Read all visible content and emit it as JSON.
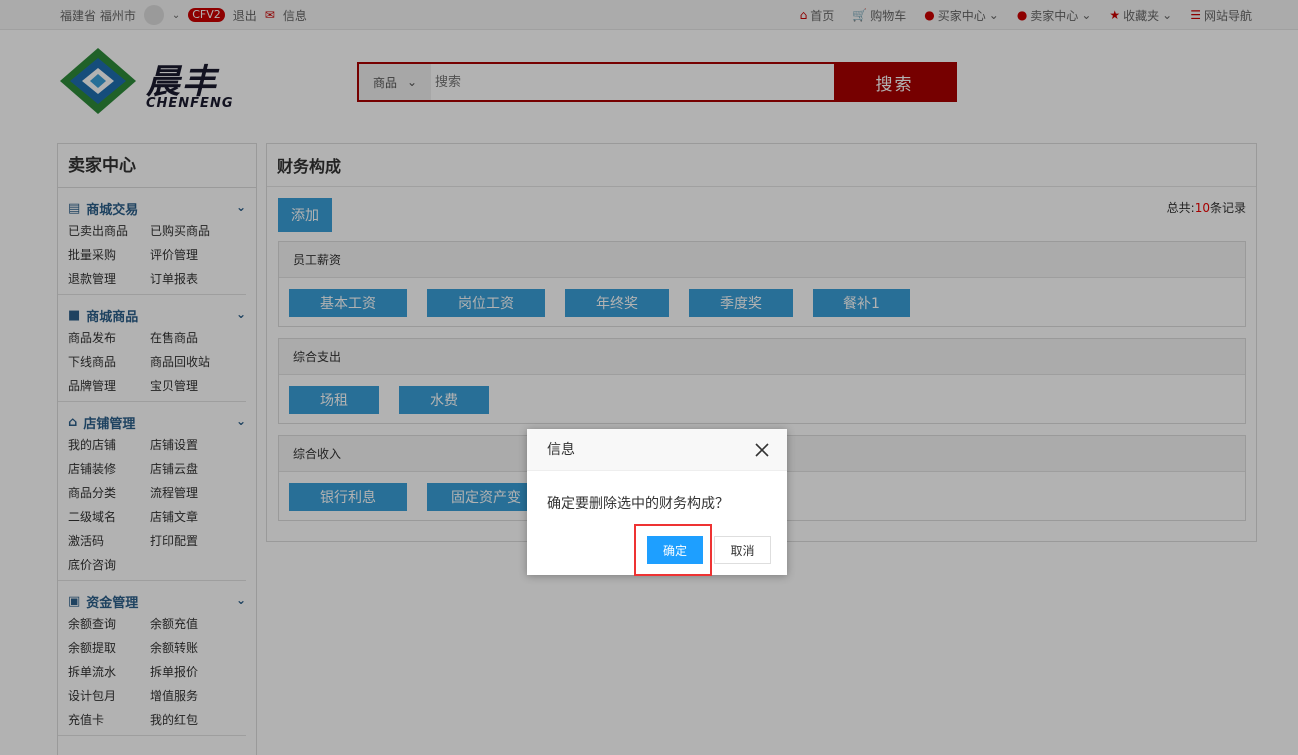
{
  "topbar": {
    "location": "福建省 福州市",
    "badge": "CFV2",
    "logout": "退出",
    "message": "信息",
    "links": [
      "首页",
      "购物车",
      "买家中心",
      "卖家中心",
      "收藏夹",
      "网站导航"
    ]
  },
  "logo": {
    "cn": "晨丰",
    "en": "CHENFENG"
  },
  "search": {
    "category": "商品",
    "placeholder": "搜索",
    "button": "搜索"
  },
  "sidebar": {
    "title": "卖家中心",
    "sections": [
      {
        "title": "商城交易",
        "items": [
          "已卖出商品",
          "已购买商品",
          "批量采购",
          "评价管理",
          "退款管理",
          "订单报表"
        ]
      },
      {
        "title": "商城商品",
        "items": [
          "商品发布",
          "在售商品",
          "下线商品",
          "商品回收站",
          "品牌管理",
          "宝贝管理"
        ]
      },
      {
        "title": "店铺管理",
        "items": [
          "我的店铺",
          "店铺设置",
          "店铺装修",
          "店铺云盘",
          "商品分类",
          "流程管理",
          "二级域名",
          "店铺文章",
          "激活码",
          "打印配置",
          "底价咨询"
        ]
      },
      {
        "title": "资金管理",
        "items": [
          "余额查询",
          "余额充值",
          "余额提取",
          "余额转账",
          "拆单流水",
          "拆单报价",
          "设计包月",
          "增值服务",
          "充值卡",
          "我的红包"
        ]
      }
    ]
  },
  "main": {
    "title": "财务构成",
    "add": "添加",
    "total_prefix": "总共:",
    "total_count": "10",
    "total_suffix": "条记录",
    "groups": [
      {
        "title": "员工薪资",
        "items": [
          "基本工资",
          "岗位工资",
          "年终奖",
          "季度奖",
          "餐补1"
        ]
      },
      {
        "title": "综合支出",
        "items": [
          "场租",
          "水费"
        ]
      },
      {
        "title": "综合收入",
        "items": [
          "银行利息",
          "固定资产变"
        ]
      }
    ]
  },
  "dialog": {
    "title": "信息",
    "message": "确定要删除选中的财务构成？",
    "ok": "确定",
    "cancel": "取消"
  },
  "colors": {
    "accent": "#3aa0d8",
    "brand_red": "#aa0000",
    "dialog_ok": "#1e9fff"
  }
}
